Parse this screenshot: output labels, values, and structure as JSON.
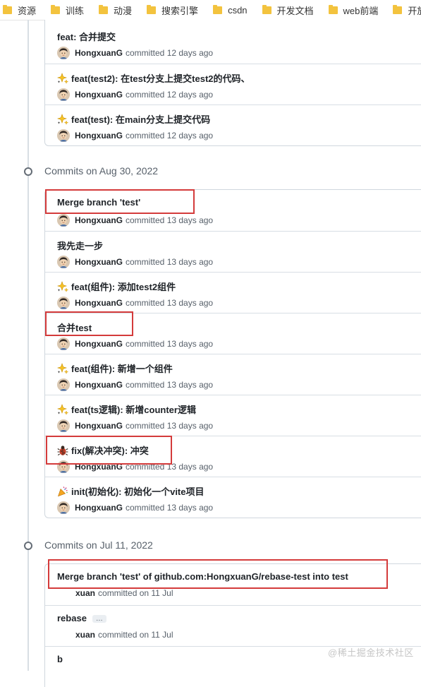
{
  "bookmarks": [
    {
      "label": "资源"
    },
    {
      "label": "训练"
    },
    {
      "label": "动漫"
    },
    {
      "label": "搜索引擎"
    },
    {
      "label": "csdn"
    },
    {
      "label": "开发文档"
    },
    {
      "label": "web前端"
    },
    {
      "label": "开放api"
    }
  ],
  "groups": [
    {
      "heading": "",
      "commits": [
        {
          "title": "feat: 合并提交",
          "emoji": "",
          "author": "HongxuanG",
          "action": "committed",
          "time": "12 days ago"
        },
        {
          "title": "feat(test2): 在test分支上提交test2的代码、",
          "emoji": "sparkles-icon",
          "author": "HongxuanG",
          "action": "committed",
          "time": "12 days ago"
        },
        {
          "title": "feat(test): 在main分支上提交代码",
          "emoji": "sparkles-icon",
          "author": "HongxuanG",
          "action": "committed",
          "time": "12 days ago"
        }
      ]
    },
    {
      "heading": "Commits on Aug 30, 2022",
      "commits": [
        {
          "title": "Merge branch 'test'",
          "emoji": "",
          "author": "HongxuanG",
          "action": "committed",
          "time": "13 days ago"
        },
        {
          "title": "我先走一步",
          "emoji": "",
          "author": "HongxuanG",
          "action": "committed",
          "time": "13 days ago"
        },
        {
          "title": "feat(组件): 添加test2组件",
          "emoji": "sparkles-icon",
          "author": "HongxuanG",
          "action": "committed",
          "time": "13 days ago"
        },
        {
          "title": "合并test",
          "emoji": "",
          "author": "HongxuanG",
          "action": "committed",
          "time": "13 days ago"
        },
        {
          "title": "feat(组件): 新增一个组件",
          "emoji": "sparkles-icon",
          "author": "HongxuanG",
          "action": "committed",
          "time": "13 days ago"
        },
        {
          "title": "feat(ts逻辑): 新增counter逻辑",
          "emoji": "sparkles-icon",
          "author": "HongxuanG",
          "action": "committed",
          "time": "13 days ago"
        },
        {
          "title": "fix(解决冲突): 冲突",
          "emoji": "bug-icon",
          "author": "HongxuanG",
          "action": "committed",
          "time": "13 days ago"
        },
        {
          "title": "init(初始化): 初始化一个vite项目",
          "emoji": "tada-icon",
          "author": "HongxuanG",
          "action": "committed",
          "time": "13 days ago"
        }
      ]
    },
    {
      "heading": "Commits on Jul 11, 2022",
      "commits": [
        {
          "title": "Merge branch 'test' of github.com:HongxuanG/rebase-test into test",
          "emoji": "",
          "author": "xuan",
          "action": "committed on",
          "time": "11 Jul",
          "more": ""
        },
        {
          "title": "rebase",
          "emoji": "",
          "author": "xuan",
          "action": "committed on",
          "time": "11 Jul",
          "more": "…"
        },
        {
          "title": "b",
          "emoji": "",
          "author": "",
          "action": "",
          "time": ""
        }
      ]
    }
  ],
  "watermark": "@稀土掘金技术社区",
  "colors": {
    "highlight": "#d43b3b",
    "timeline": "#d8dee4",
    "folder": "#f3c33e"
  }
}
